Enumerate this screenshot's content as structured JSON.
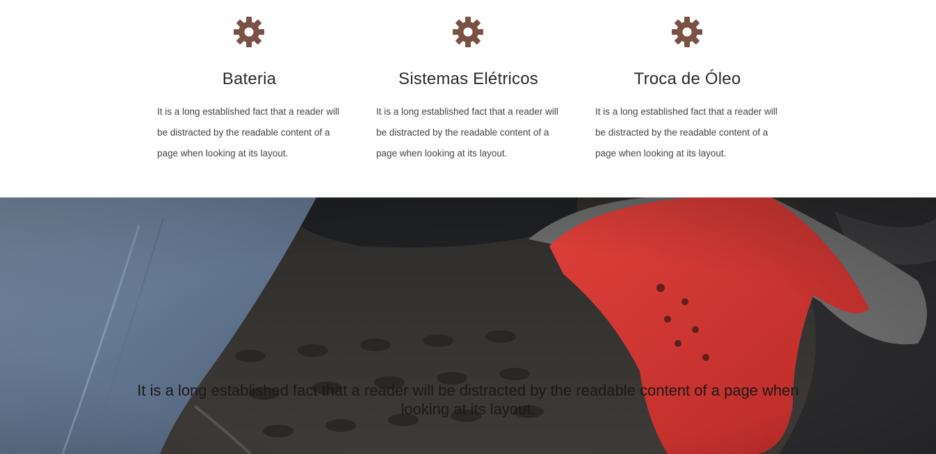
{
  "colors": {
    "icon": "#7a5245",
    "heading": "#2a2a2a",
    "text": "#444444"
  },
  "services": [
    {
      "icon": "gear-icon",
      "title": "Bateria",
      "description": "It is a long established fact that a reader will be distracted by the readable content of a page when looking at its layout."
    },
    {
      "icon": "gear-icon",
      "title": "Sistemas Elétricos",
      "description": "It is a long established fact that a reader will be distracted by the readable content of a page when looking at its layout."
    },
    {
      "icon": "gear-icon",
      "title": "Troca de Óleo",
      "description": "It is a long established fact that a reader will be distracted by the readable content of a page when looking at its layout."
    }
  ],
  "hero": {
    "caption": "It is a long established fact that a reader will be distracted by the readable content of a page when looking at its layout."
  }
}
